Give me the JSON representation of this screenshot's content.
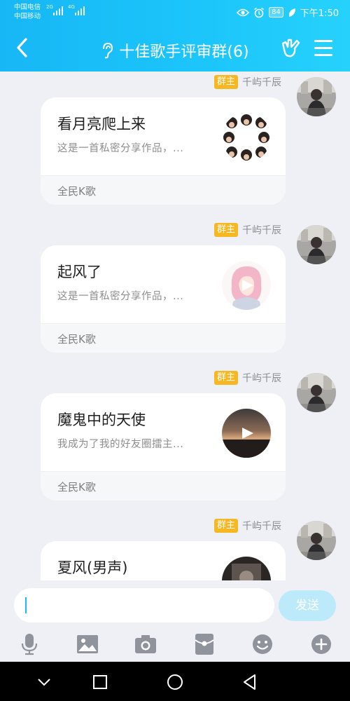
{
  "status_bar": {
    "carrier_1": "中国电信",
    "carrier_2": "中国移动",
    "net_1": "2G",
    "net_2": "4G",
    "battery": "84",
    "time": "下午1:50"
  },
  "header": {
    "title": "十佳歌手评审群(6)",
    "icons": [
      "back-arrow",
      "ear-icon",
      "hand-gesture-icon",
      "menu-icon"
    ]
  },
  "messages": [
    {
      "badge": "群主",
      "nickname": "千屿千辰",
      "title": "看月亮爬上来",
      "desc": "这是一首私密分享作品，...",
      "source": "全民K歌",
      "cover": "photo-grid"
    },
    {
      "badge": "群主",
      "nickname": "千屿千辰",
      "title": "起风了",
      "desc": "这是一首私密分享作品，...",
      "source": "全民K歌",
      "cover": "pink-hair-anime"
    },
    {
      "badge": "群主",
      "nickname": "千屿千辰",
      "title": "魔鬼中的天使",
      "desc": "我成为了我的好友圈擂主...",
      "source": "全民K歌",
      "cover": "sunset"
    },
    {
      "badge": "群主",
      "nickname": "千屿千辰",
      "title": "夏风(男声)",
      "desc": "",
      "source": "",
      "cover": "dark-photo"
    }
  ],
  "input": {
    "placeholder": "",
    "send_label": "发送"
  },
  "toolbar": [
    "microphone-icon",
    "image-icon",
    "camera-icon",
    "red-packet-icon",
    "emoji-icon",
    "plus-icon"
  ],
  "colors": {
    "accent": "#1cc6fb",
    "badge": "#f5b822",
    "send_disabled": "#bdeafb"
  }
}
